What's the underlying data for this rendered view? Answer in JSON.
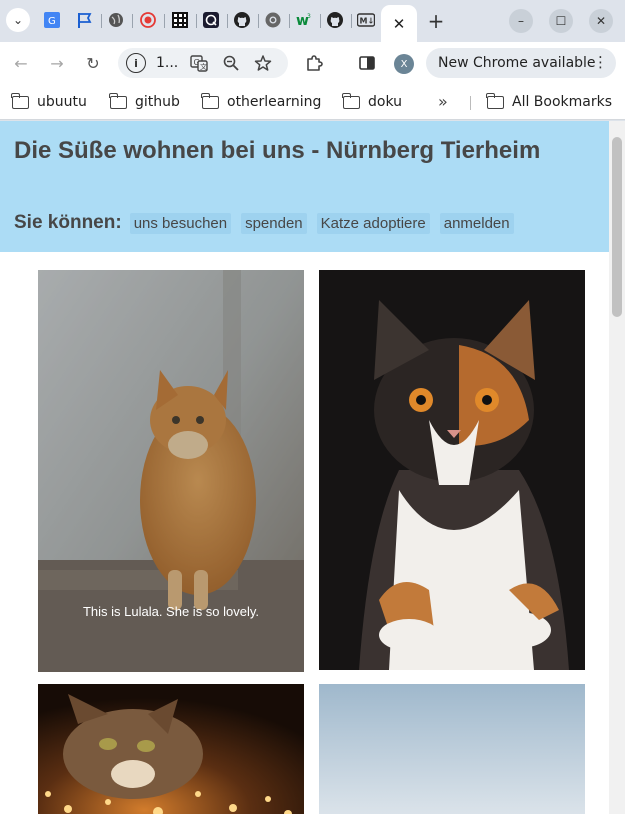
{
  "browser": {
    "tabs_menu_icon": "chevron-down-icon",
    "tab_favicons": [
      "google-translate-icon",
      "flag-icon",
      "globe-icon",
      "record-icon",
      "grid-icon",
      "app-icon",
      "github-icon",
      "chrome-icon",
      "w-icon",
      "github-icon",
      "markdown-icon"
    ],
    "active_tab_close": "✕",
    "new_tab": "+",
    "window_controls": {
      "minimize": "–",
      "maximize": "☐",
      "close": "✕"
    },
    "address_bar": {
      "text": "1...",
      "info_icon": "i"
    },
    "profile_initial": "X",
    "update_button": {
      "label": "New Chrome available",
      "menu": "⋮"
    },
    "bookmarks": [
      "ubuutu",
      "github",
      "otherlearning",
      "doku"
    ],
    "bookmarks_overflow": "»",
    "all_bookmarks": "All Bookmarks"
  },
  "page": {
    "title": "Die Süße wohnen bei uns - Nürnberg Tierheim",
    "nav_label": "Sie können:",
    "nav_links": [
      "uns besuchen",
      "spenden",
      "Katze adoptiere",
      "anmelden"
    ],
    "gallery": [
      {
        "caption": "This is Lulala. She is so lovely."
      }
    ]
  },
  "colors": {
    "header_bg": "#acdcf5",
    "nav_link_bg": "#9ed2ef",
    "text": "#474747"
  }
}
